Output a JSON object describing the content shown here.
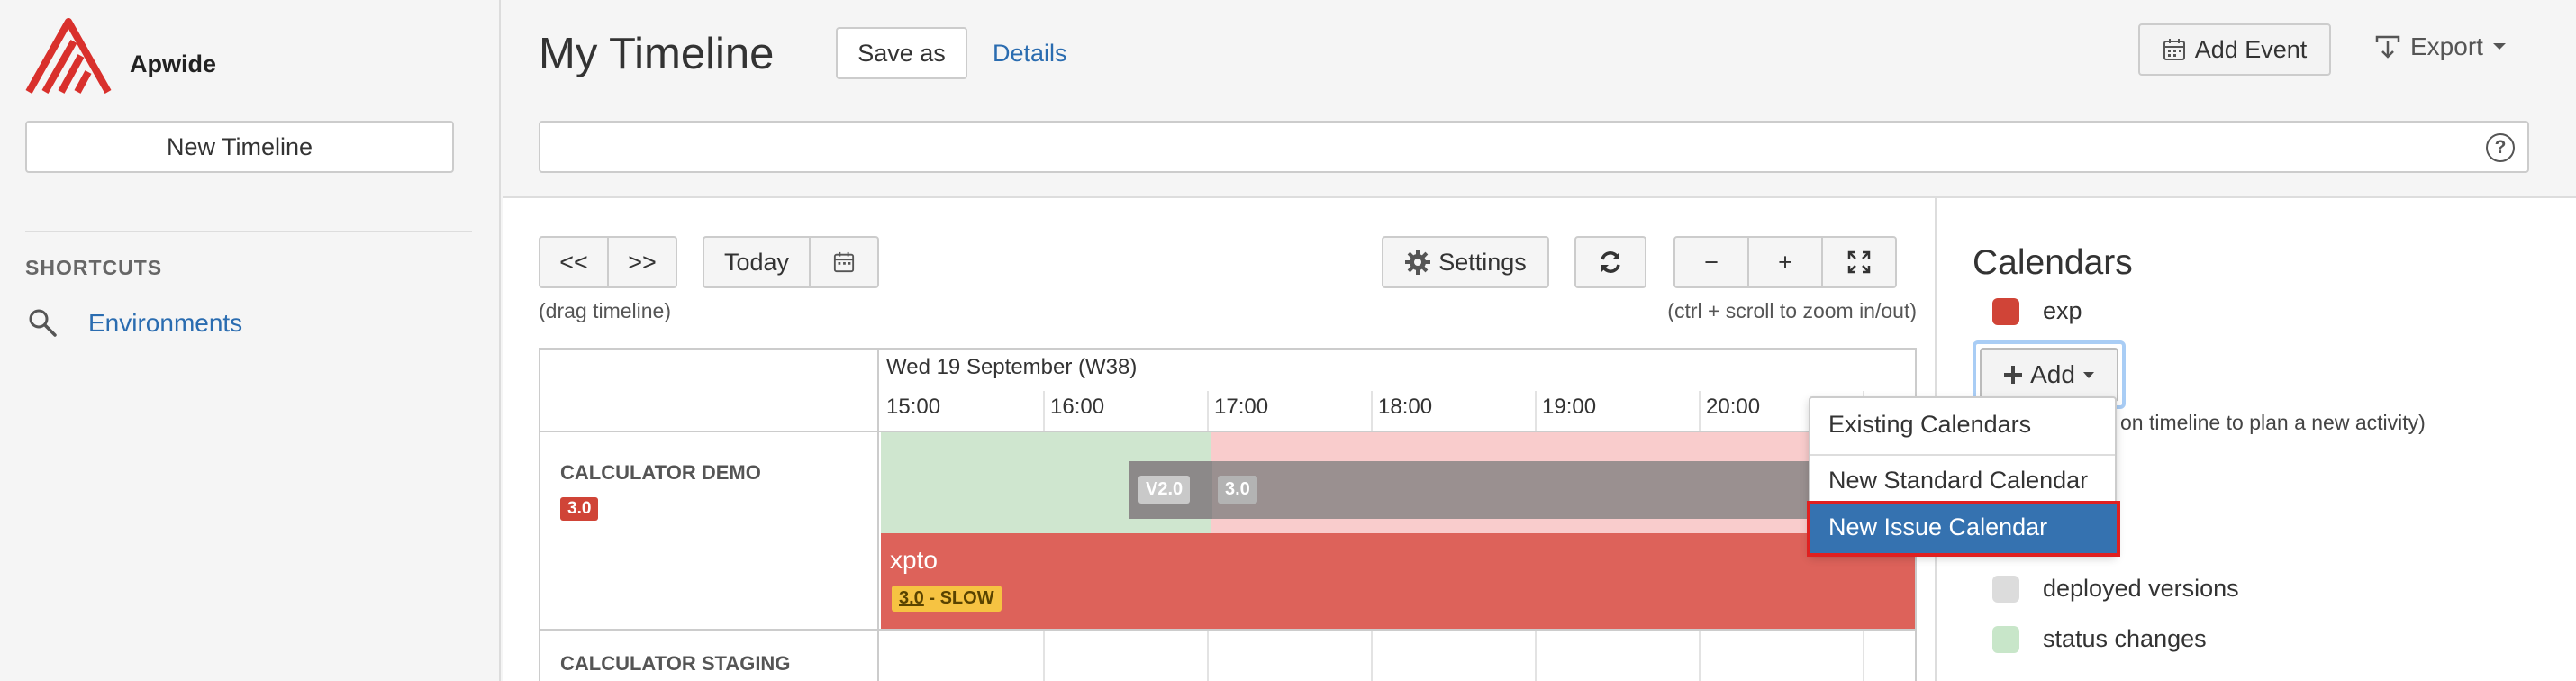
{
  "brand": {
    "name": "Apwide",
    "accent": "#d9302c"
  },
  "sidebar": {
    "new_timeline_label": "New Timeline",
    "shortcuts_title": "SHORTCUTS",
    "shortcuts": [
      {
        "label": "Environments",
        "icon": "search-icon"
      }
    ]
  },
  "header": {
    "title": "My Timeline",
    "save_as_label": "Save as",
    "details_label": "Details",
    "add_event_label": "Add Event",
    "export_label": "Export",
    "help_label": "?"
  },
  "toolbar": {
    "prev_label": "<<",
    "next_label": ">>",
    "today_label": "Today",
    "drag_hint": "(drag timeline)",
    "settings_label": "Settings",
    "zoom_out_label": "−",
    "zoom_in_label": "+",
    "zoom_hint": "(ctrl + scroll to zoom in/out)"
  },
  "timeline": {
    "date_label": "Wed 19 September (W38)",
    "hours": [
      "15:00",
      "16:00",
      "17:00",
      "18:00",
      "19:00",
      "20:00"
    ],
    "rows": [
      {
        "label": "CALCULATOR DEMO",
        "badge": "3.0"
      },
      {
        "label": "CALCULATOR STAGING"
      }
    ],
    "versions": [
      "V2.0",
      "3.0"
    ],
    "event": {
      "title": "xpto",
      "badge_version": "3.0",
      "badge_status": " - SLOW"
    }
  },
  "calendars": {
    "title": "Calendars",
    "items": [
      {
        "label": "exp",
        "color": "#d04437"
      },
      {
        "label": "deployed versions",
        "color": "#dcdcdc"
      },
      {
        "label": "status changes",
        "color": "#c8e6c9"
      }
    ],
    "add_label": "Add",
    "add_hint": "on timeline to plan a new activity)"
  },
  "add_menu": {
    "items": [
      "Existing Calendars",
      "New Standard Calendar",
      "New Issue Calendar"
    ],
    "selected": "New Issue Calendar"
  }
}
